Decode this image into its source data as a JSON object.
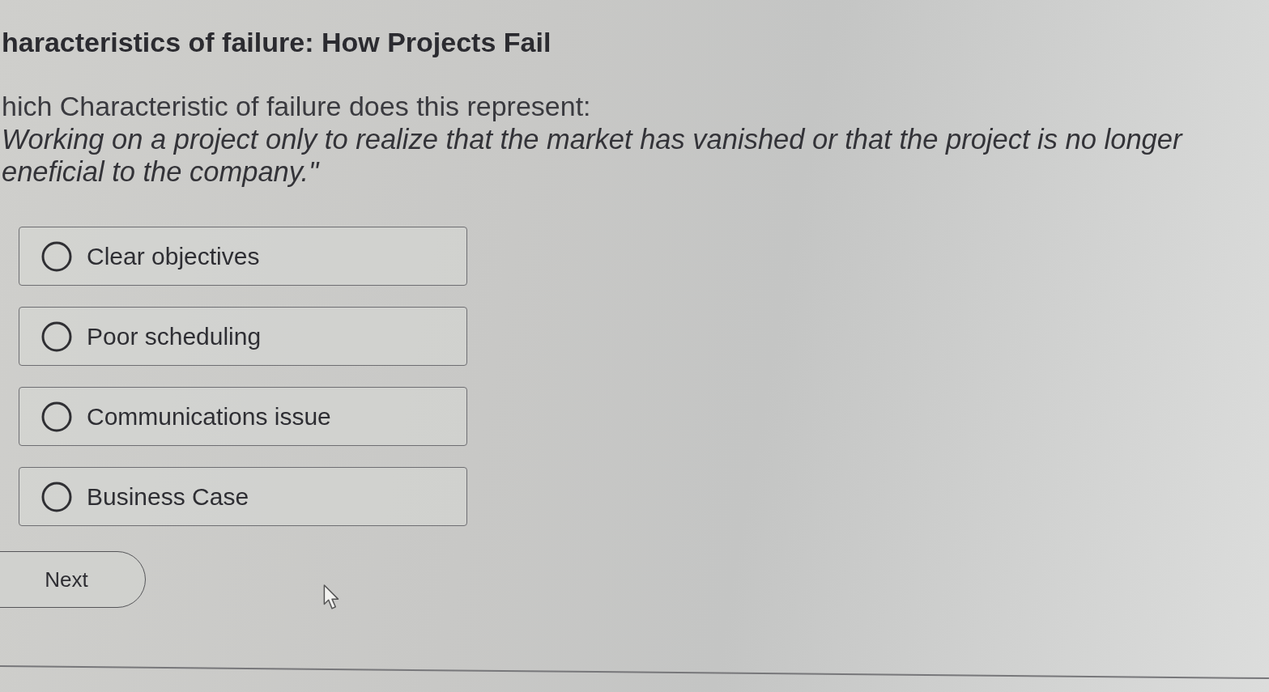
{
  "title": "haracteristics of failure: How Projects Fail",
  "question": {
    "prompt": "hich Characteristic of failure does this represent:",
    "quote_lines": [
      "Working on a project only to realize that the market has vanished or that the project is no longer",
      "eneficial to the company.\""
    ]
  },
  "options": [
    {
      "label": "Clear objectives",
      "selected": false
    },
    {
      "label": "Poor scheduling",
      "selected": false
    },
    {
      "label": "Communications issue",
      "selected": false
    },
    {
      "label": "Business Case",
      "selected": false
    }
  ],
  "next_button": {
    "label": "Next"
  }
}
